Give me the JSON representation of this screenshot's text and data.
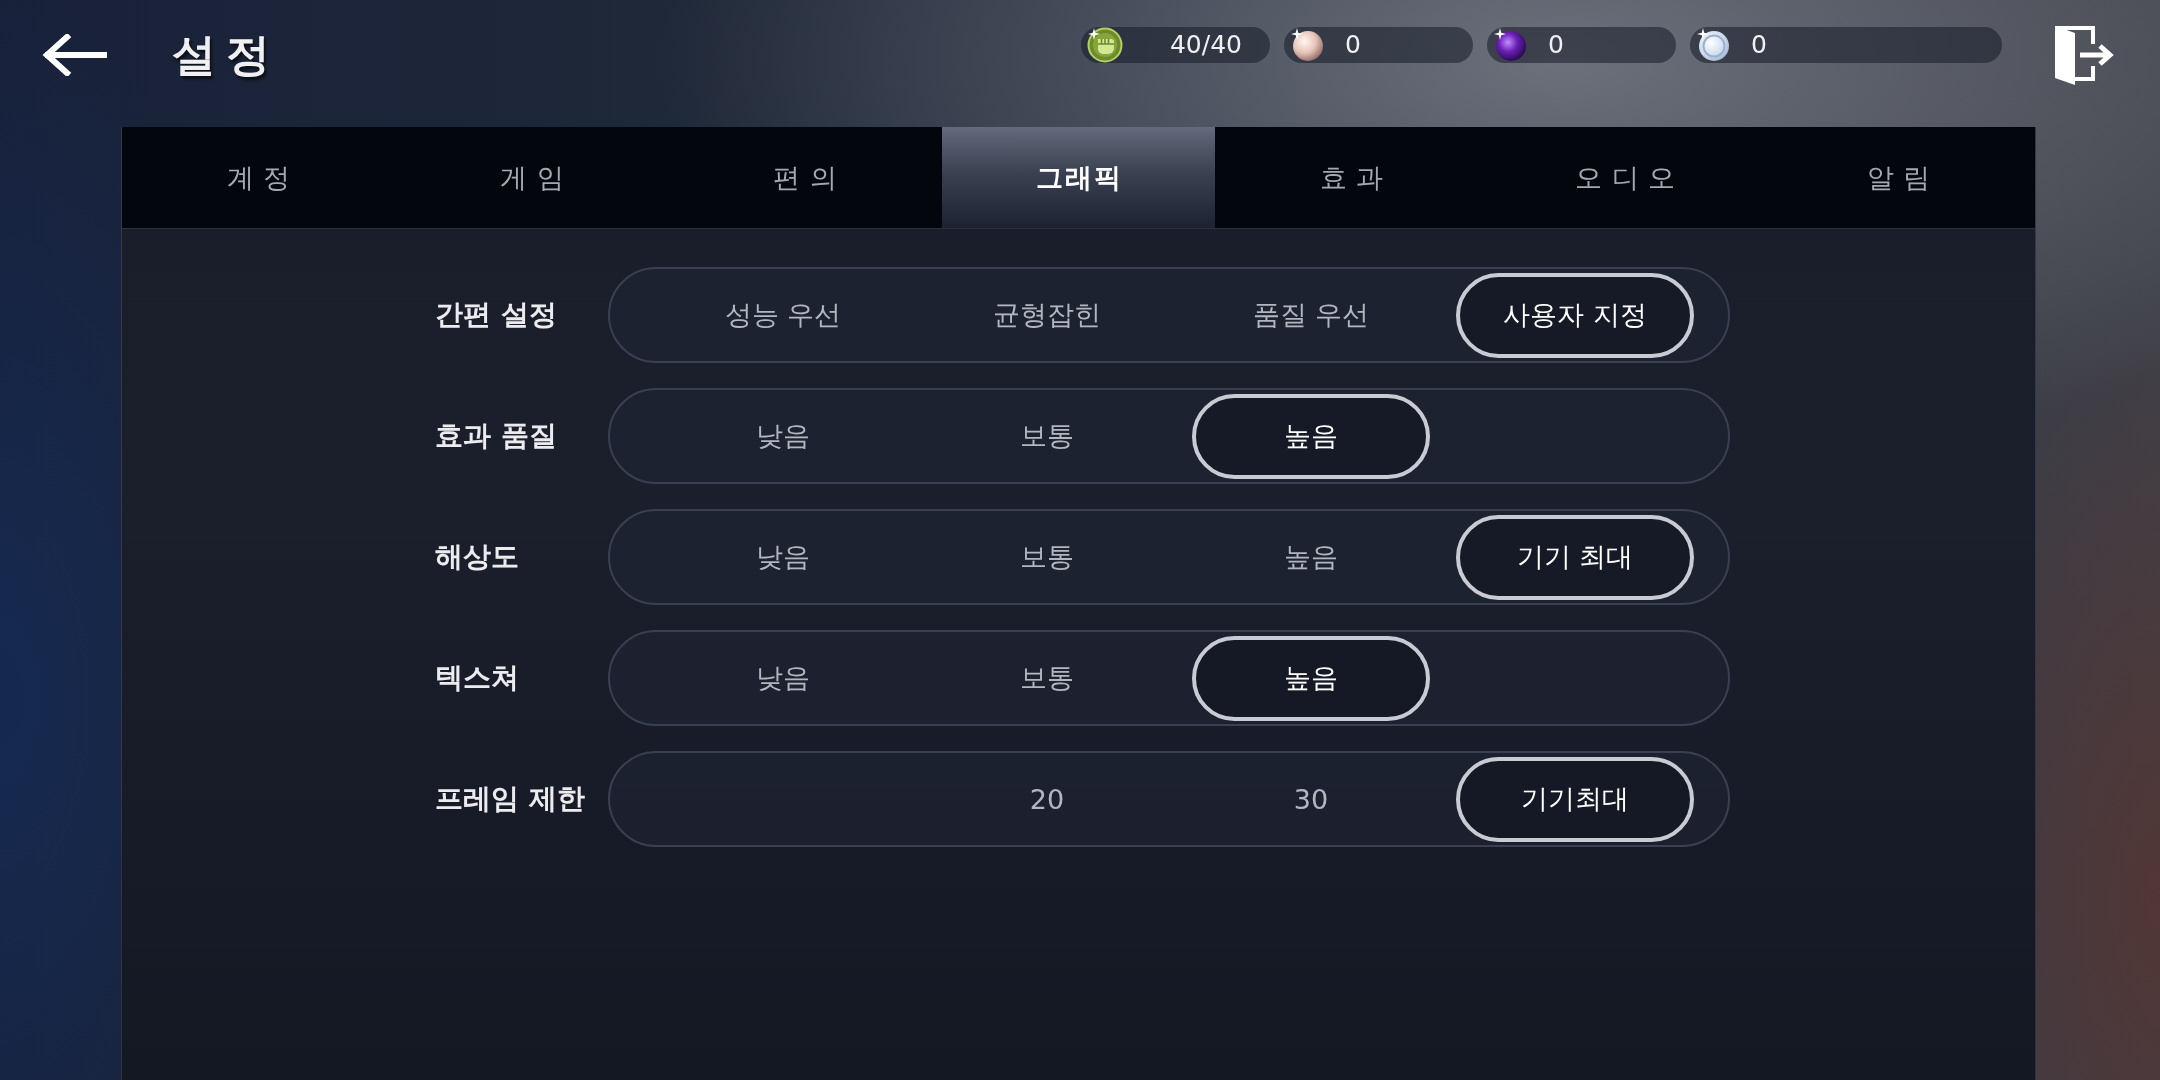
{
  "header": {
    "title": "설정"
  },
  "currencies": [
    {
      "kind": "stamina",
      "amount": "40/40"
    },
    {
      "kind": "pearl",
      "amount": "0"
    },
    {
      "kind": "orb",
      "amount": "0"
    },
    {
      "kind": "coin",
      "amount": "0"
    }
  ],
  "tabs": [
    {
      "label": "계정",
      "selected": false
    },
    {
      "label": "게임",
      "selected": false
    },
    {
      "label": "편의",
      "selected": false
    },
    {
      "label": "그래픽",
      "selected": true
    },
    {
      "label": "효과",
      "selected": false
    },
    {
      "label": "오디오",
      "selected": false
    },
    {
      "label": "알림",
      "selected": false
    }
  ],
  "settings": [
    {
      "kind": "full",
      "label": "간편 설정",
      "options": [
        {
          "label": "성능 우선",
          "selected": false
        },
        {
          "label": "균형잡힌",
          "selected": false
        },
        {
          "label": "품질 우선",
          "selected": false
        },
        {
          "label": "사용자 지정",
          "selected": true
        }
      ]
    },
    {
      "kind": "leading",
      "label": "효과 품질",
      "options": [
        {
          "label": "낮음",
          "selected": false
        },
        {
          "label": "보통",
          "selected": false
        },
        {
          "label": "높음",
          "selected": true
        }
      ]
    },
    {
      "kind": "full",
      "label": "해상도",
      "options": [
        {
          "label": "낮음",
          "selected": false
        },
        {
          "label": "보통",
          "selected": false
        },
        {
          "label": "높음",
          "selected": false
        },
        {
          "label": "기기 최대",
          "selected": true
        }
      ]
    },
    {
      "kind": "leading",
      "label": "텍스쳐",
      "options": [
        {
          "label": "낮음",
          "selected": false
        },
        {
          "label": "보통",
          "selected": false
        },
        {
          "label": "높음",
          "selected": true
        }
      ]
    },
    {
      "kind": "trailing",
      "label": "프레임 제한",
      "options": [
        {
          "label": "20",
          "selected": false
        },
        {
          "label": "30",
          "selected": false
        },
        {
          "label": "기기최대",
          "selected": true
        }
      ]
    }
  ]
}
